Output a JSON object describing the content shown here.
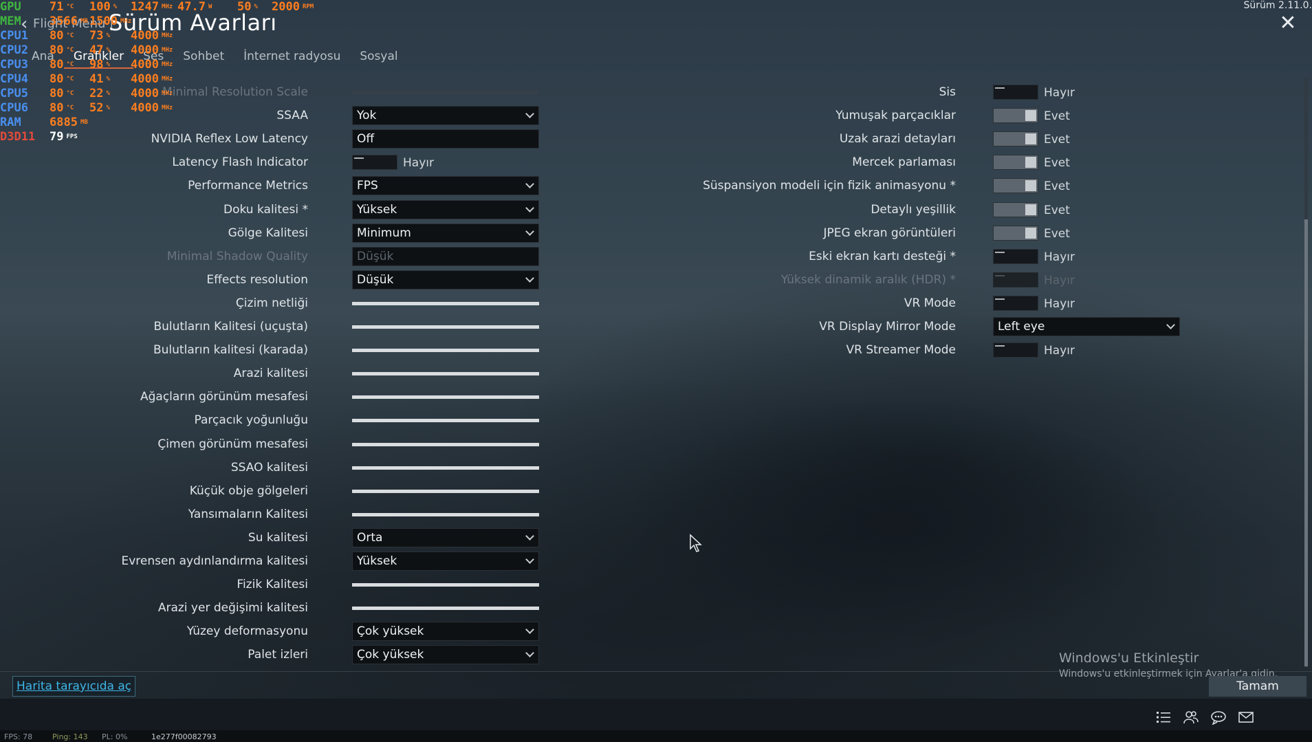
{
  "header": {
    "crumb": "Flight Menu |",
    "title": "Sürüm Avarları",
    "version": "Sürüm 2.11.0.",
    "close_label": "✕"
  },
  "tabs": [
    {
      "label": "Ana"
    },
    {
      "label": "Grafikler"
    },
    {
      "label": "Ses"
    },
    {
      "label": "Sohbet"
    },
    {
      "label": "İnternet radyosu"
    },
    {
      "label": "Sosyal"
    }
  ],
  "osd": [
    {
      "label": "GPU",
      "label_color": "#3fb73f",
      "values": [
        {
          "v": "71",
          "u": "°C"
        },
        {
          "v": "100",
          "u": "%"
        },
        {
          "v": "1247",
          "u": "MHz"
        },
        {
          "v": "47.7",
          "u": "W"
        },
        {
          "v": "50",
          "u": "%"
        },
        {
          "v": "2000",
          "u": "RPM"
        }
      ]
    },
    {
      "label": "MEM",
      "label_color": "#3fb73f",
      "values": [
        {
          "v": "3566",
          "u": "MB"
        },
        {
          "v": "1500",
          "u": "MHz"
        }
      ]
    },
    {
      "label": "CPU1",
      "label_color": "#4a8ff0",
      "values": [
        {
          "v": "80",
          "u": "°C"
        },
        {
          "v": "73",
          "u": "%"
        },
        {
          "v": "4000",
          "u": "MHz"
        }
      ]
    },
    {
      "label": "CPU2",
      "label_color": "#4a8ff0",
      "values": [
        {
          "v": "80",
          "u": "°C"
        },
        {
          "v": "47",
          "u": "%"
        },
        {
          "v": "4000",
          "u": "MHz"
        }
      ]
    },
    {
      "label": "CPU3",
      "label_color": "#4a8ff0",
      "values": [
        {
          "v": "80",
          "u": "°C"
        },
        {
          "v": "98",
          "u": "%"
        },
        {
          "v": "4000",
          "u": "MHz"
        }
      ]
    },
    {
      "label": "CPU4",
      "label_color": "#4a8ff0",
      "values": [
        {
          "v": "80",
          "u": "°C"
        },
        {
          "v": "41",
          "u": "%"
        },
        {
          "v": "4000",
          "u": "MHz"
        }
      ]
    },
    {
      "label": "CPU5",
      "label_color": "#4a8ff0",
      "values": [
        {
          "v": "80",
          "u": "°C"
        },
        {
          "v": "22",
          "u": "%"
        },
        {
          "v": "4000",
          "u": "MHz"
        }
      ]
    },
    {
      "label": "CPU6",
      "label_color": "#4a8ff0",
      "values": [
        {
          "v": "80",
          "u": "°C"
        },
        {
          "v": "52",
          "u": "%"
        },
        {
          "v": "4000",
          "u": "MHz"
        }
      ]
    },
    {
      "label": "RAM",
      "label_color": "#4a8ff0",
      "values": [
        {
          "v": "6885",
          "u": "MB"
        }
      ]
    },
    {
      "label": "D3D11",
      "label_color": "#e24a3c",
      "values": [
        {
          "v": "79",
          "u": "FPS",
          "white": true
        }
      ]
    }
  ],
  "left_settings": [
    {
      "label": "Minimal Resolution Scale",
      "type": "slider",
      "value": 1.0,
      "dim": true
    },
    {
      "label": "SSAA",
      "type": "dropdown",
      "value": "Yok"
    },
    {
      "label": "NVIDIA Reflex Low Latency",
      "type": "dropdown",
      "value": "Off",
      "nochev": true
    },
    {
      "label": "Latency Flash Indicator",
      "type": "toggle",
      "state": false,
      "value": "Hayır"
    },
    {
      "label": "Performance Metrics",
      "type": "dropdown",
      "value": "FPS"
    },
    {
      "label": "Doku kalitesi *",
      "type": "dropdown",
      "value": "Yüksek"
    },
    {
      "label": "Gölge Kalitesi",
      "type": "dropdown",
      "value": "Minimum"
    },
    {
      "label": "Minimal Shadow Quality",
      "type": "dropdown",
      "value": "Düşük",
      "dim": true
    },
    {
      "label": "Effects resolution",
      "type": "dropdown",
      "value": "Düşük"
    },
    {
      "label": "Çizim netliği",
      "type": "slider",
      "value": 1.0
    },
    {
      "label": "Bulutların Kalitesi (uçuşta)",
      "type": "slider",
      "value": 1.0
    },
    {
      "label": "Bulutların kalitesi (karada)",
      "type": "slider",
      "value": 1.0
    },
    {
      "label": "Arazi kalitesi",
      "type": "slider",
      "value": 1.0
    },
    {
      "label": "Ağaçların görünüm mesafesi",
      "type": "slider",
      "value": 1.0
    },
    {
      "label": "Parçacık yoğunluğu",
      "type": "slider",
      "value": 1.0
    },
    {
      "label": "Çimen görünüm mesafesi",
      "type": "slider",
      "value": 1.0
    },
    {
      "label": "SSAO kalitesi",
      "type": "slider",
      "value": 1.0
    },
    {
      "label": "Küçük obje gölgeleri",
      "type": "slider",
      "value": 1.0
    },
    {
      "label": "Yansımaların Kalitesi",
      "type": "slider",
      "value": 1.0
    },
    {
      "label": "Su kalitesi",
      "type": "dropdown",
      "value": "Orta"
    },
    {
      "label": "Evrensen aydınlandırma kalitesi",
      "type": "dropdown",
      "value": "Yüksek"
    },
    {
      "label": "Fizik Kalitesi",
      "type": "slider",
      "value": 1.0
    },
    {
      "label": "Arazi yer değişimi kalitesi",
      "type": "slider",
      "value": 1.0
    },
    {
      "label": "Yüzey deformasyonu",
      "type": "dropdown",
      "value": "Çok yüksek"
    },
    {
      "label": "Palet izleri",
      "type": "dropdown",
      "value": "Çok yüksek"
    }
  ],
  "right_settings": [
    {
      "label": "Sis",
      "type": "toggle",
      "state": false,
      "value": "Hayır"
    },
    {
      "label": "Yumuşak parçacıklar",
      "type": "toggle",
      "state": true,
      "value": "Evet"
    },
    {
      "label": "Uzak arazi detayları",
      "type": "toggle",
      "state": true,
      "value": "Evet"
    },
    {
      "label": "Mercek parlaması",
      "type": "toggle",
      "state": true,
      "value": "Evet"
    },
    {
      "label": "Süspansiyon modeli için fizik animasyonu *",
      "type": "toggle",
      "state": true,
      "value": "Evet"
    },
    {
      "label": "Detaylı yeşillik",
      "type": "toggle",
      "state": true,
      "value": "Evet"
    },
    {
      "label": "JPEG ekran görüntüleri",
      "type": "toggle",
      "state": true,
      "value": "Evet"
    },
    {
      "label": "Eski ekran kartı desteği *",
      "type": "toggle",
      "state": false,
      "value": "Hayır"
    },
    {
      "label": "Yüksek dinamik aralık (HDR) *",
      "type": "toggle",
      "state": false,
      "value": "Hayır",
      "dim": true
    },
    {
      "label": "VR Mode",
      "type": "toggle",
      "state": false,
      "value": "Hayır"
    },
    {
      "label": "VR Display Mirror Mode",
      "type": "dropdown",
      "value": "Left eye"
    },
    {
      "label": "VR Streamer Mode",
      "type": "toggle",
      "state": false,
      "value": "Hayır"
    }
  ],
  "footer": {
    "map_link": "Harita tarayıcıda aç",
    "ok_label": "Tamam",
    "win_activate_title": "Windows'u Etkinleştir",
    "win_activate_sub": "Windows'u etkinleştirmek için Ayarlar'a gidin."
  },
  "taskbar_icons": [
    "list-icon",
    "friends-icon",
    "chat-icon",
    "mail-icon"
  ],
  "status_bar": {
    "fps": "FPS: 78",
    "ping": "Ping: 143",
    "pl": "PL: 0%",
    "hash": "1e277f00082793"
  },
  "colors": {
    "active_tab_underline": "#d9673b",
    "link": "#3fb6e8",
    "osd_value": "#ff7e1f"
  }
}
